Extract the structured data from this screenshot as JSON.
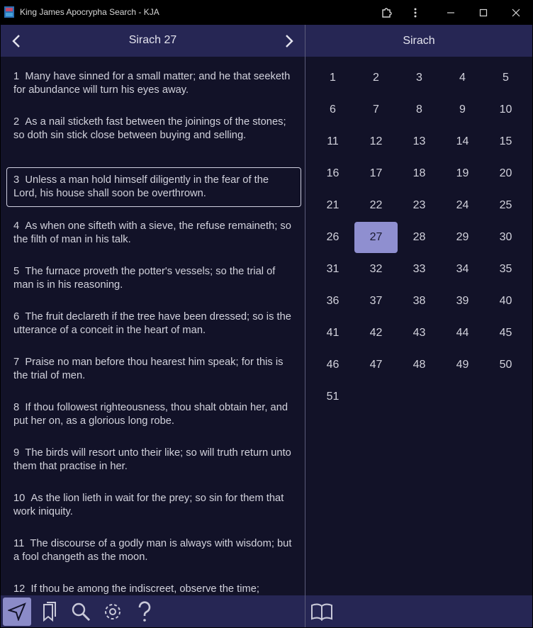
{
  "window": {
    "title": "King James Apocrypha Search - KJA"
  },
  "chapter_header": {
    "title": "Sirach 27",
    "prev_icon": "chevron-left-icon",
    "next_icon": "chevron-right-icon"
  },
  "book_header": {
    "title": "Sirach"
  },
  "verses": [
    {
      "num": "1",
      "text": "Many have sinned for a small matter; and he that seeketh for abundance will turn his eyes away."
    },
    {
      "num": "2",
      "text": "As a nail sticketh fast between the joinings of the stones; so doth sin stick close between buying and selling."
    },
    {
      "num": "3",
      "text": "Unless a man hold himself diligently in the fear of the Lord, his house shall soon be overthrown."
    },
    {
      "num": "4",
      "text": "As when one sifteth with a sieve, the refuse remaineth; so the filth of man in his talk."
    },
    {
      "num": "5",
      "text": "The furnace proveth the potter's vessels; so the trial of man is in his reasoning."
    },
    {
      "num": "6",
      "text": "The fruit declareth if the tree have been dressed; so is the utterance of a conceit in the heart of man."
    },
    {
      "num": "7",
      "text": "Praise no man before thou hearest him speak; for this is the trial of men."
    },
    {
      "num": "8",
      "text": "If thou followest righteousness, thou shalt obtain her, and put her on, as a glorious long robe."
    },
    {
      "num": "9",
      "text": "The birds will resort unto their like; so will truth return unto them that practise in her."
    },
    {
      "num": "10",
      "text": "As the lion lieth in wait for the prey; so sin for them that work iniquity."
    },
    {
      "num": "11",
      "text": "The discourse of a godly man is always with wisdom; but a fool changeth as the moon."
    },
    {
      "num": "12",
      "text": "If thou be among the indiscreet, observe the time;"
    }
  ],
  "selected_verse": "3",
  "chapters": [
    "1",
    "2",
    "3",
    "4",
    "5",
    "6",
    "7",
    "8",
    "9",
    "10",
    "11",
    "12",
    "13",
    "14",
    "15",
    "16",
    "17",
    "18",
    "19",
    "20",
    "21",
    "22",
    "23",
    "24",
    "25",
    "26",
    "27",
    "28",
    "29",
    "30",
    "31",
    "32",
    "33",
    "34",
    "35",
    "36",
    "37",
    "38",
    "39",
    "40",
    "41",
    "42",
    "43",
    "44",
    "45",
    "46",
    "47",
    "48",
    "49",
    "50",
    "51"
  ],
  "active_chapter": "27",
  "toolbar": {
    "icons": [
      "navigate-icon",
      "bookmarks-icon",
      "search-icon",
      "settings-icon",
      "help-icon"
    ],
    "right_icons": [
      "book-icon"
    ],
    "active": "navigate-icon"
  },
  "colors": {
    "background": "#121228",
    "header": "#262654",
    "active_chapter": "#8f8fd0",
    "active_tool": "#8b8bc8"
  }
}
